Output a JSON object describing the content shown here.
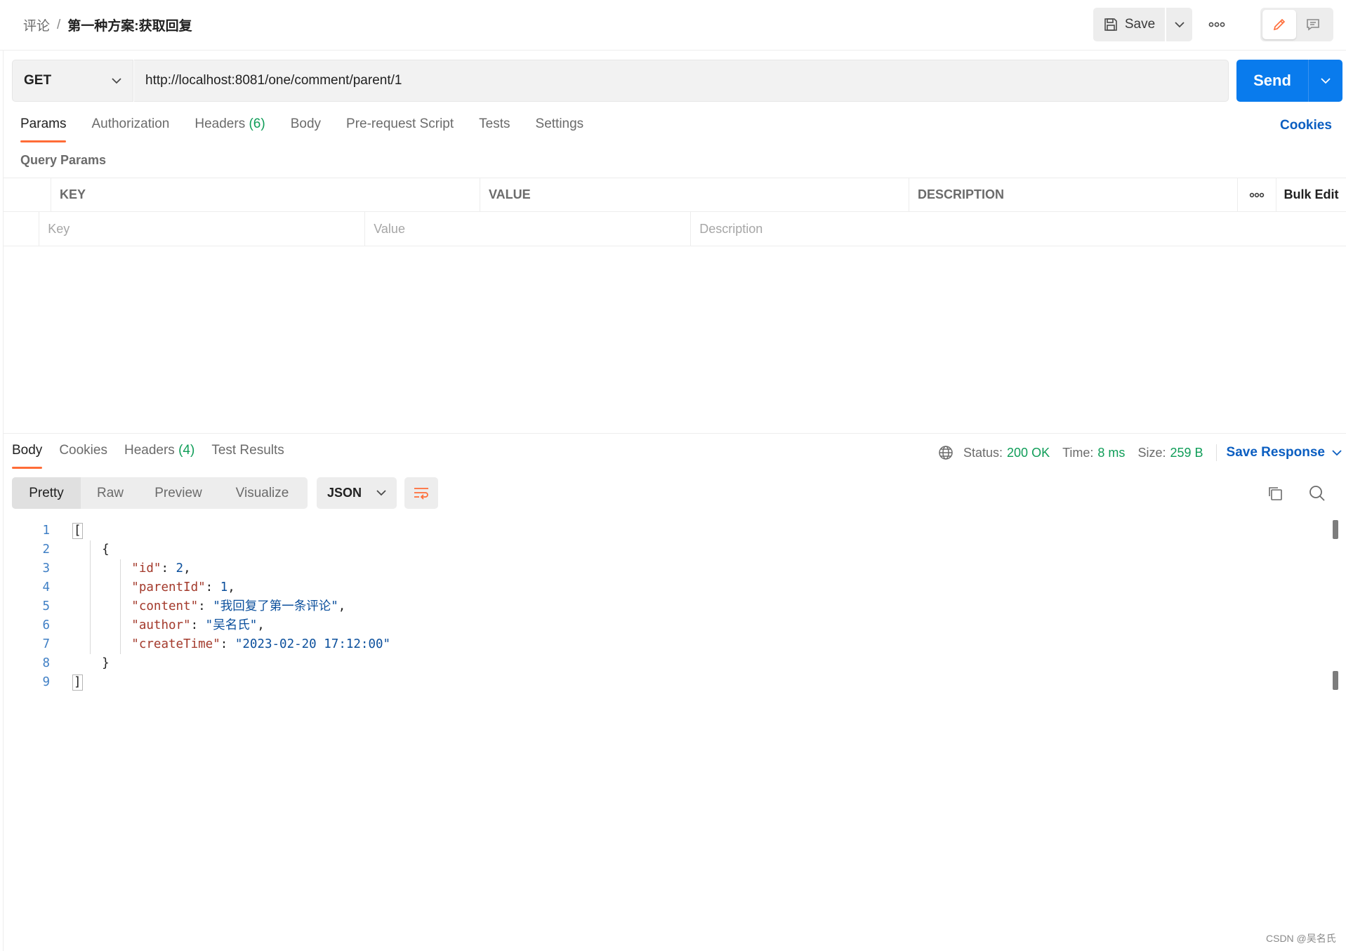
{
  "breadcrumb": {
    "parent": "评论",
    "separator": "/",
    "current": "第一种方案:获取回复"
  },
  "header": {
    "save_label": "Save"
  },
  "request": {
    "method": "GET",
    "url": "http://localhost:8081/one/comment/parent/1",
    "send_label": "Send"
  },
  "request_tabs": {
    "params": "Params",
    "authorization": "Authorization",
    "headers": "Headers",
    "headers_count": "(6)",
    "body": "Body",
    "prerequest": "Pre-request Script",
    "tests": "Tests",
    "settings": "Settings",
    "cookies": "Cookies"
  },
  "query_params": {
    "title": "Query Params",
    "columns": {
      "key": "KEY",
      "value": "VALUE",
      "description": "DESCRIPTION",
      "bulk_edit": "Bulk Edit"
    },
    "placeholders": {
      "key": "Key",
      "value": "Value",
      "description": "Description"
    }
  },
  "response_tabs": {
    "body": "Body",
    "cookies": "Cookies",
    "headers": "Headers",
    "headers_count": "(4)",
    "test_results": "Test Results"
  },
  "response_status": {
    "status_label": "Status:",
    "status_value": "200 OK",
    "time_label": "Time:",
    "time_value": "8 ms",
    "size_label": "Size:",
    "size_value": "259 B",
    "save_response": "Save Response"
  },
  "view_tabs": {
    "pretty": "Pretty",
    "raw": "Raw",
    "preview": "Preview",
    "visualize": "Visualize"
  },
  "format": "JSON",
  "code": {
    "line_numbers": [
      "1",
      "2",
      "3",
      "4",
      "5",
      "6",
      "7",
      "8",
      "9"
    ],
    "open_array": "[",
    "open_obj": "{",
    "close_obj": "}",
    "close_array": "]",
    "fields": [
      {
        "key": "\"id\"",
        "value": "2"
      },
      {
        "key": "\"parentId\"",
        "value": "1"
      },
      {
        "key": "\"content\"",
        "value": "\"我回复了第一条评论\""
      },
      {
        "key": "\"author\"",
        "value": "\"吴名氏\""
      },
      {
        "key": "\"createTime\"",
        "value": "\"2023-02-20 17:12:00\""
      }
    ]
  },
  "watermark": "CSDN @吴名氏",
  "colors": {
    "accent": "#ff6c37",
    "send": "#097bed",
    "link": "#0b5ec1",
    "success": "#0f9d58"
  }
}
